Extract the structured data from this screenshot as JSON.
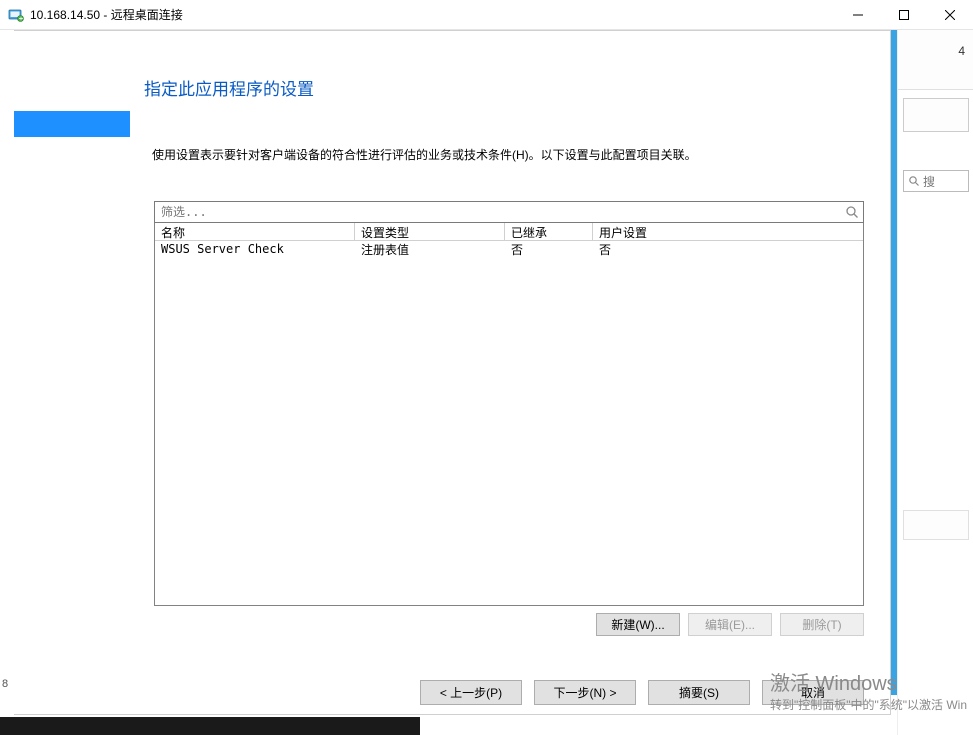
{
  "titlebar": {
    "title": "10.168.14.50 - 远程桌面连接"
  },
  "modal": {
    "heading": "指定此应用程序的设置",
    "description": "使用设置表示要针对客户端设备的符合性进行评估的业务或技术条件(H)。以下设置与此配置项目关联。",
    "filter_placeholder": "筛选...",
    "columns": {
      "name": "名称",
      "type": "设置类型",
      "inherited": "已继承",
      "user_setting": "用户设置"
    },
    "rows": [
      {
        "name": "WSUS Server Check",
        "type": "注册表值",
        "inherited": "否",
        "user_setting": "否"
      }
    ],
    "table_buttons": {
      "new": "新建(W)...",
      "edit": "编辑(E)...",
      "delete": "删除(T)"
    },
    "wizard_buttons": {
      "prev": "< 上一步(P)",
      "next": "下一步(N) >",
      "summary": "摘要(S)",
      "cancel": "取消"
    }
  },
  "right_panel": {
    "label_fragment": "4",
    "search_fragment": "搜"
  },
  "watermark": {
    "title": "激活 Windows",
    "sub": "转到\"控制面板\"中的\"系统\"以激活 Win"
  },
  "left_edge_fragments": [
    "",
    "",
    "8"
  ]
}
